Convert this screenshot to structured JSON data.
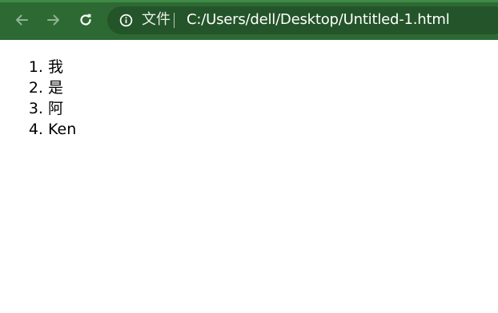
{
  "browser": {
    "back_icon": "arrow-left-icon",
    "forward_icon": "arrow-right-icon",
    "reload_icon": "reload-icon",
    "info_icon": "info-icon",
    "file_label": "文件",
    "url": "C:/Users/dell/Desktop/Untitled-1.html",
    "colors": {
      "toolbar": "#2d6a33",
      "omnibox": "#245429"
    }
  },
  "page": {
    "list_items": [
      "我",
      "是",
      "阿",
      "Ken"
    ]
  }
}
